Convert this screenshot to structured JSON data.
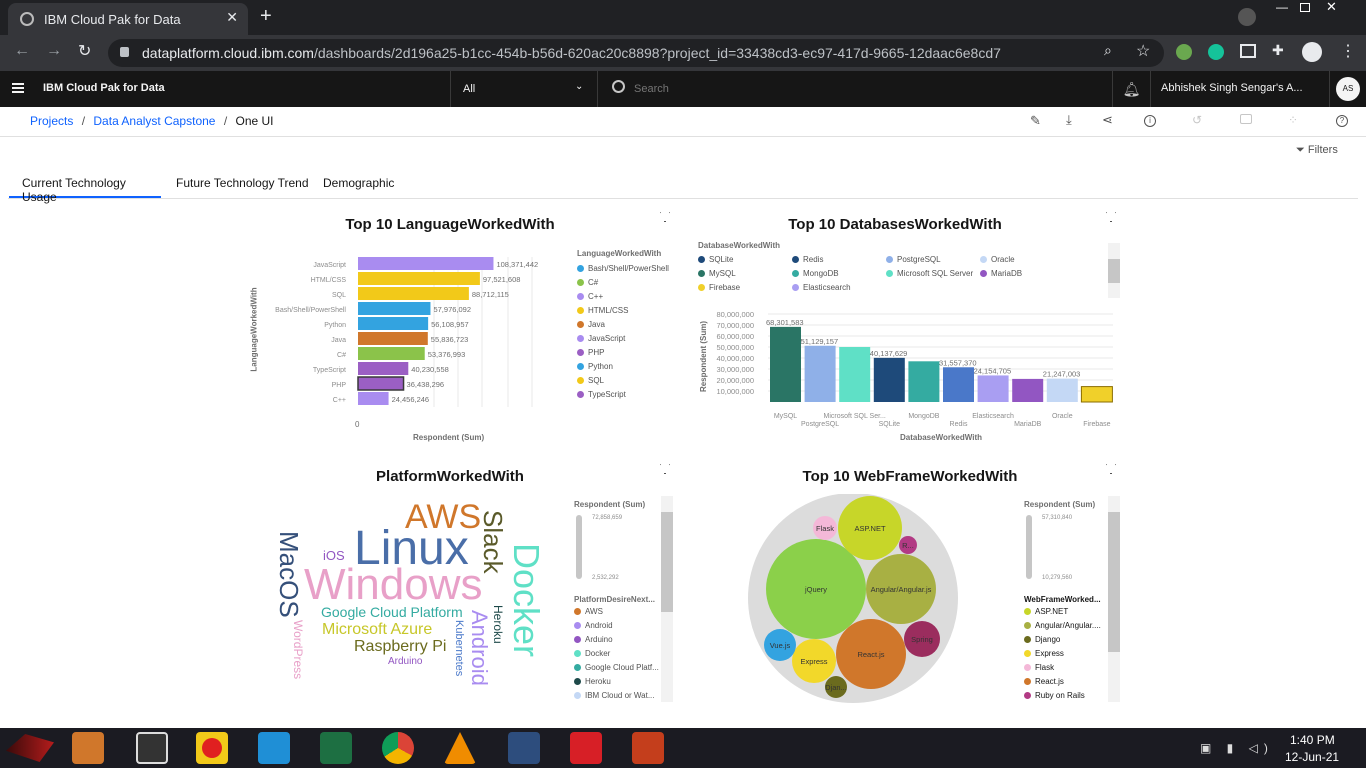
{
  "browser": {
    "tab_title": "IBM Cloud Pak for Data",
    "url_domain": "dataplatform.cloud.ibm.com",
    "url_path": "/dashboards/2d196a25-b1cc-454b-b56d-620ac20c8898?project_id=33438cd3-ec97-417d-9665-12daac6e8cd7"
  },
  "header": {
    "product": "IBM Cloud Pak for Data",
    "scope": "All",
    "search_placeholder": "Search",
    "user": "Abhishek Singh Sengar's A...",
    "avatar": "AS"
  },
  "breadcrumb": {
    "c1": "Projects",
    "c2": "Data Analyst Capstone",
    "c3": "One UI"
  },
  "filters_label": "Filters",
  "tabs": [
    "Current Technology Usage",
    "Future Technology Trend",
    "Demographic"
  ],
  "lang": {
    "title": "Top 10 LanguageWorkedWith",
    "ylabel": "LanguageWorkedWith",
    "xlabel": "Respondent (Sum)",
    "zero": "0",
    "legend_title": "LanguageWorkedWith",
    "legend": [
      "Bash/Shell/PowerShell",
      "C#",
      "C++",
      "HTML/CSS",
      "Java",
      "JavaScript",
      "PHP",
      "Python",
      "SQL",
      "TypeScript"
    ]
  },
  "db": {
    "title": "Top 10 DatabasesWorkedWith",
    "legend_title": "DatabaseWorkedWith",
    "legend": [
      "SQLite",
      "Redis",
      "PostgreSQL",
      "Oracle",
      "MySQL",
      "MongoDB",
      "Microsoft SQL Server",
      "MariaDB",
      "Firebase",
      "Elasticsearch"
    ],
    "ylabel": "Respondent (Sum)",
    "xlabel": "DatabaseWorkedWith",
    "yticks": [
      "80,000,000",
      "70,000,000",
      "60,000,000",
      "50,000,000",
      "40,000,000",
      "30,000,000",
      "20,000,000",
      "10,000,000"
    ]
  },
  "platform": {
    "title": "PlatformWorkedWith",
    "legend_title": "Respondent (Sum)",
    "max": "72,858,659",
    "min": "2,532,292",
    "legend2_title": "PlatformDesireNext...",
    "legend2": [
      "AWS",
      "Android",
      "Arduino",
      "Docker",
      "Google Cloud Platf...",
      "Heroku",
      "IBM Cloud or Wat..."
    ],
    "words": [
      "AWS",
      "Linux",
      "Windows",
      "Slack",
      "Docker",
      "MacOS",
      "iOS",
      "Google Cloud Platform",
      "Microsoft Azure",
      "Raspberry Pi",
      "Arduino",
      "Android",
      "Heroku",
      "Kubernetes",
      "WordPress"
    ]
  },
  "web": {
    "title": "Top 10 WebFrameWorkedWith",
    "legend_title": "Respondent (Sum)",
    "max": "57,310,840",
    "min": "10,279,560",
    "legend2_title": "WebFrameWorked...",
    "legend2": [
      "ASP.NET",
      "Angular/Angular....",
      "Django",
      "Express",
      "Flask",
      "React.js",
      "Ruby on Rails"
    ],
    "bubbles": [
      "jQuery",
      "ASP.NET",
      "Angular/Angular.js",
      "React.js",
      "Express",
      "Vue.js",
      "Spring",
      "Flask",
      "R...",
      "Djan..."
    ]
  },
  "taskbar": {
    "time": "1:40 PM",
    "date": "12-Jun-21"
  },
  "chart_data": [
    {
      "type": "bar",
      "title": "Top 10 LanguageWorkedWith",
      "orientation": "horizontal",
      "categories": [
        "JavaScript",
        "HTML/CSS",
        "SQL",
        "Bash/Shell/PowerShell",
        "Python",
        "Java",
        "C#",
        "TypeScript",
        "PHP",
        "C++"
      ],
      "values": [
        108371442,
        97521608,
        88712115,
        57976092,
        56108957,
        55836723,
        53376993,
        40230558,
        36438296,
        24456246
      ],
      "labels": [
        "108,371,442",
        "97,521,608",
        "88,712,115",
        "57,976,092",
        "56,108,957",
        "55,836,723",
        "53,376,993",
        "40,230,558",
        "36,438,296",
        "24,456,246"
      ],
      "colors": [
        "#a98cf0",
        "#f2c919",
        "#f2c919",
        "#33a3e0",
        "#33a3e0",
        "#d0772b",
        "#8bc34a",
        "#9b5fc4",
        "#9b5fc4",
        "#a98cf0"
      ],
      "xlim": [
        0,
        160000000
      ],
      "xlabel": "Respondent (Sum)",
      "ylabel": "LanguageWorkedWith"
    },
    {
      "type": "bar",
      "title": "Top 10 DatabasesWorkedWith",
      "categories": [
        "MySQL",
        "PostgreSQL",
        "Microsoft SQL Server",
        "SQLite",
        "MongoDB",
        "Redis",
        "Elasticsearch",
        "MariaDB",
        "Oracle",
        "Firebase"
      ],
      "tick_labels": [
        "MySQL",
        "PostgreSQL",
        "Microsoft SQL Ser...",
        "SQLite",
        "MongoDB",
        "Redis",
        "Elasticsearch",
        "MariaDB",
        "Oracle",
        "Firebase"
      ],
      "values": [
        68301583,
        51129157,
        50000000,
        40137629,
        37000000,
        31557370,
        24154705,
        21000000,
        21247003,
        14000000
      ],
      "labels": [
        "68,301,583",
        "51,129,157",
        "",
        "40,137,629",
        "",
        "31,557,370",
        "24,154,705",
        "",
        "21,247,003",
        ""
      ],
      "colors": [
        "#2a7565",
        "#8fb0e8",
        "#5fe0c6",
        "#1e4a7a",
        "#34aba1",
        "#4a78c9",
        "#a99ef2",
        "#9256c2",
        "#c4d8f5",
        "#f0d02a"
      ],
      "ylim": [
        0,
        80000000
      ],
      "xlabel": "DatabaseWorkedWith",
      "ylabel": "Respondent (Sum)"
    }
  ]
}
